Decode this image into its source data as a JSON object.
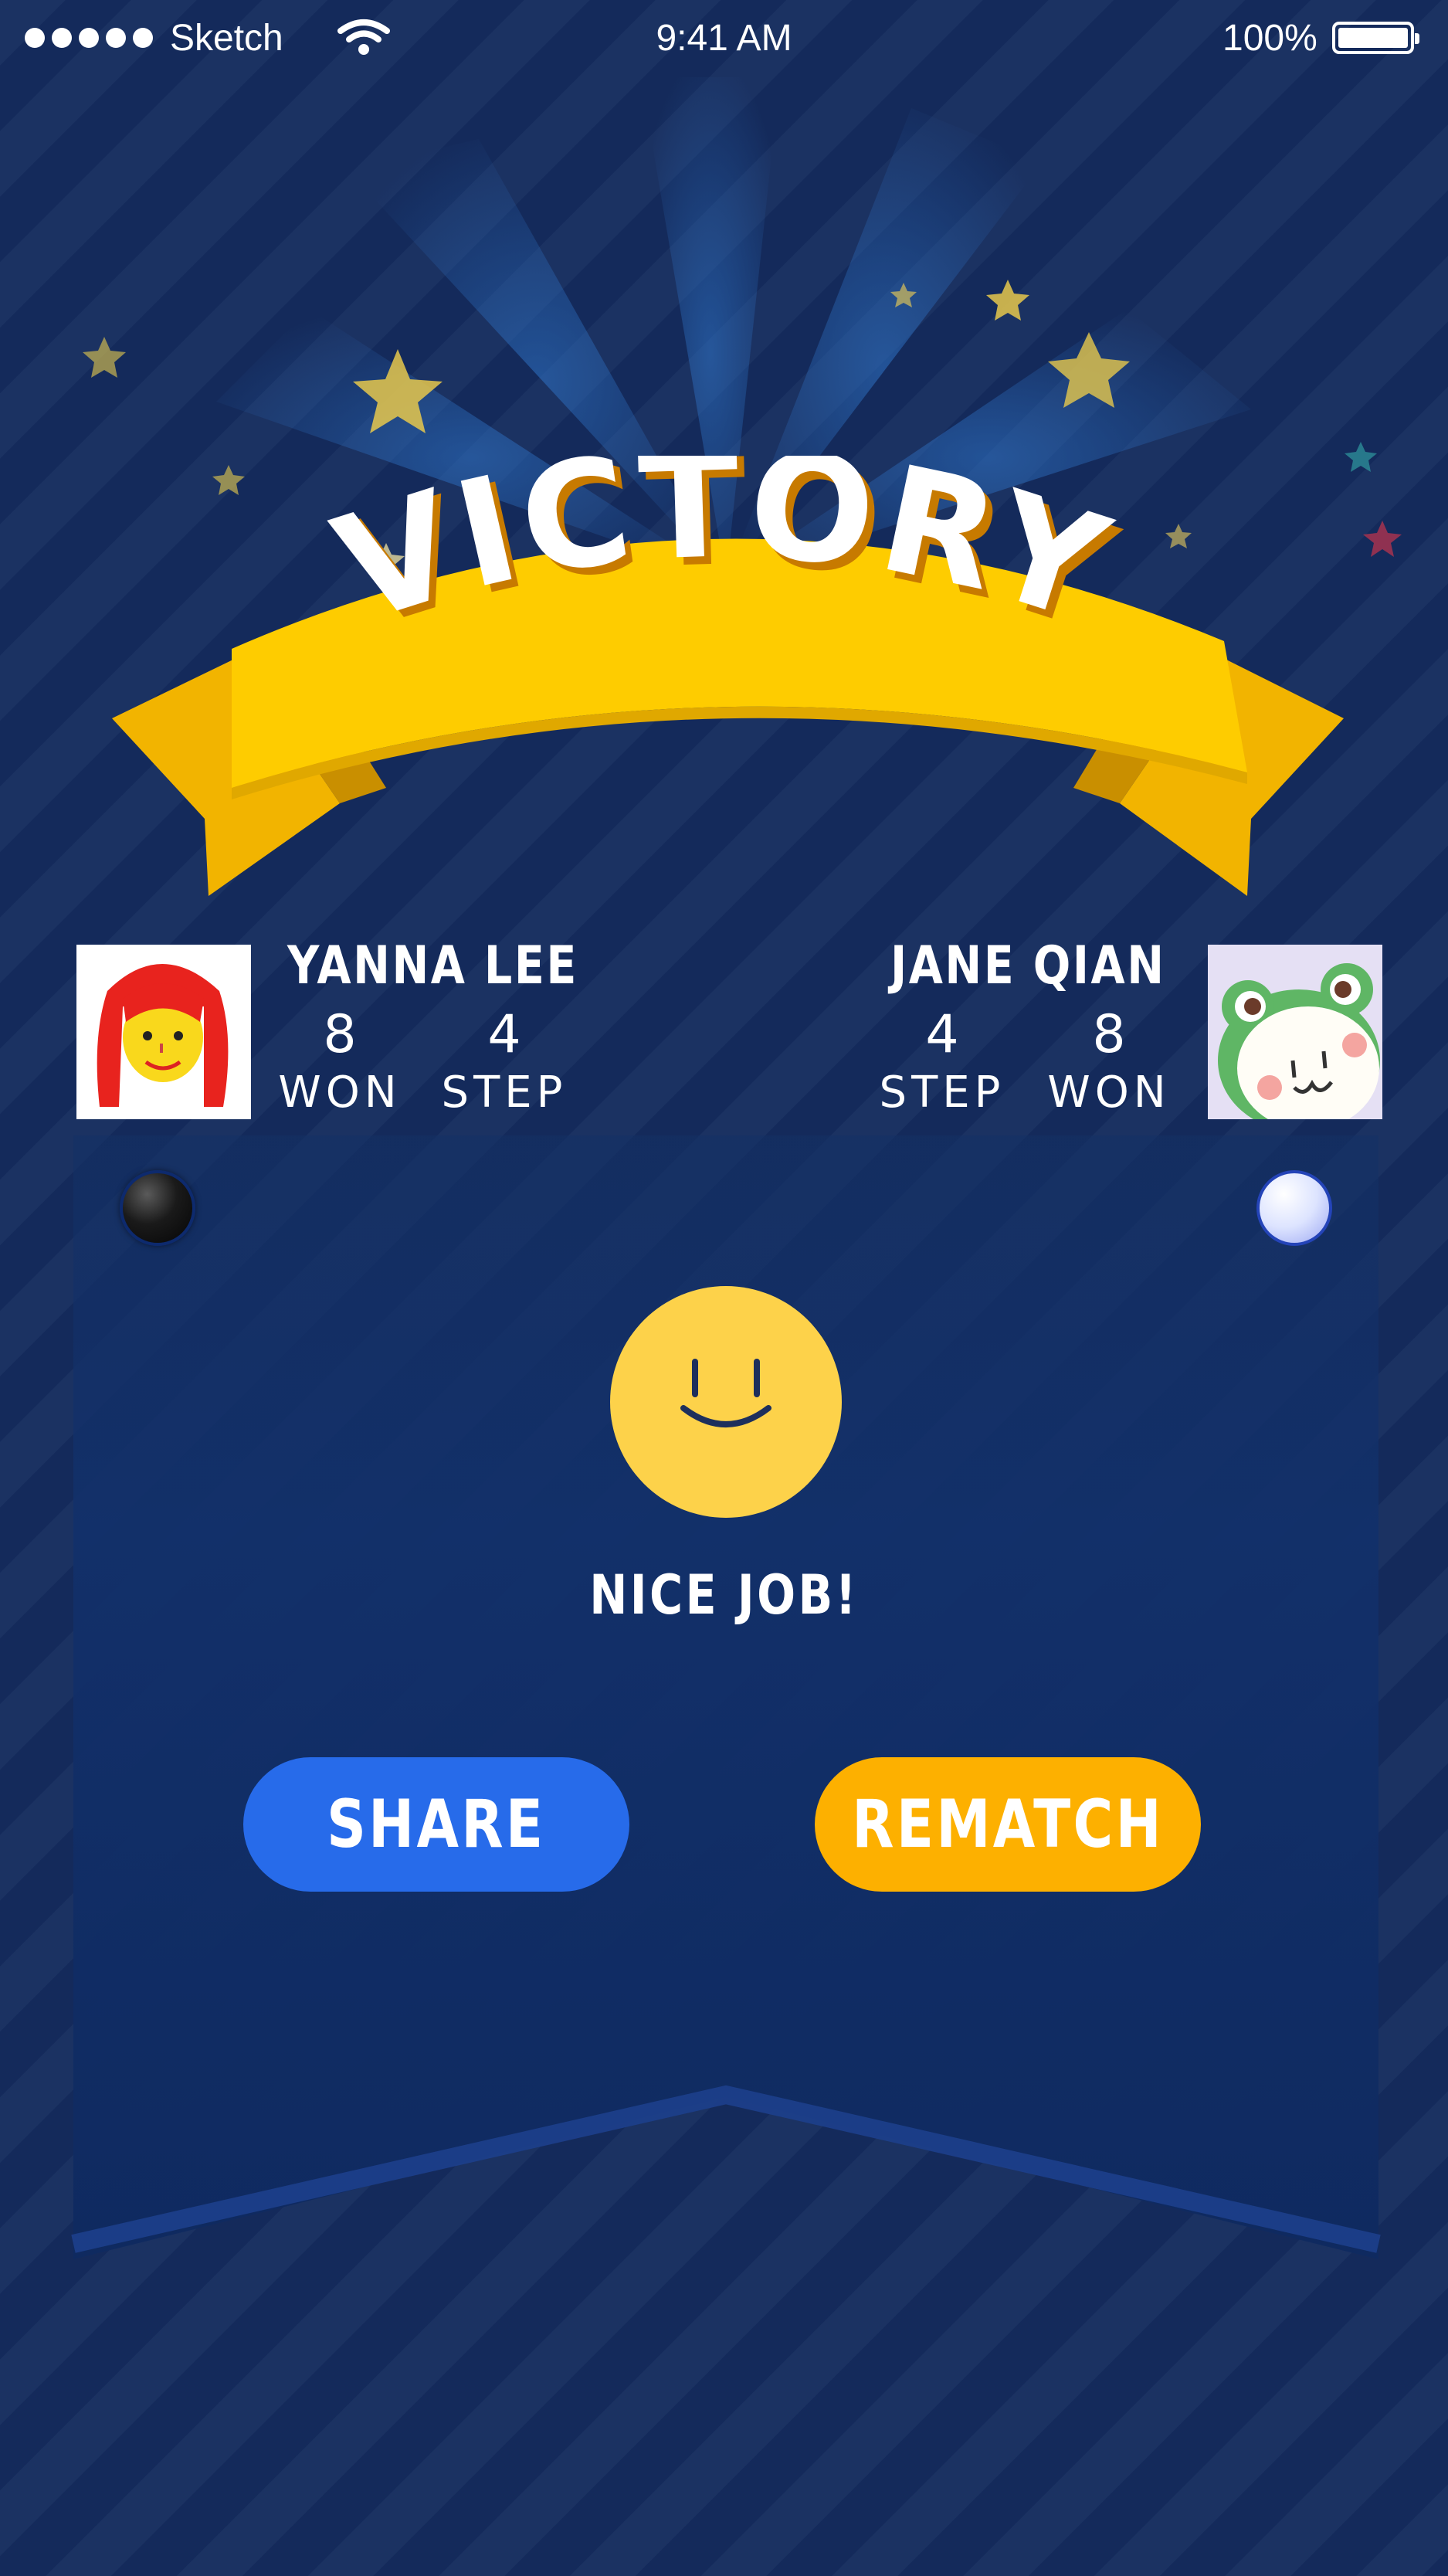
{
  "status_bar": {
    "carrier": "Sketch",
    "time": "9:41 AM",
    "battery": "100%",
    "icons": [
      "signal-dots-icon",
      "wifi-icon",
      "battery-icon"
    ]
  },
  "header": {
    "title": "VICTORY",
    "icons": [
      "star-icon",
      "ribbon-banner"
    ]
  },
  "players": {
    "left": {
      "name": "YANNA LEE",
      "won_value": "8",
      "won_label": "WON",
      "step_value": "4",
      "step_label": "STEP",
      "piece": "black"
    },
    "right": {
      "name": "JANE QIAN",
      "won_value": "8",
      "won_label": "WON",
      "step_value": "4",
      "step_label": "STEP",
      "piece": "white"
    }
  },
  "result": {
    "icon": "smiley-face-icon",
    "message": "NICE JOB!"
  },
  "actions": {
    "share_label": "SHARE",
    "rematch_label": "REMATCH"
  },
  "colors": {
    "background": "#152c5e",
    "panel": "#123068",
    "banner": "#fecc00",
    "share_button": "#276bea",
    "rematch_button": "#fdb000",
    "smiley": "#fdd24a"
  }
}
